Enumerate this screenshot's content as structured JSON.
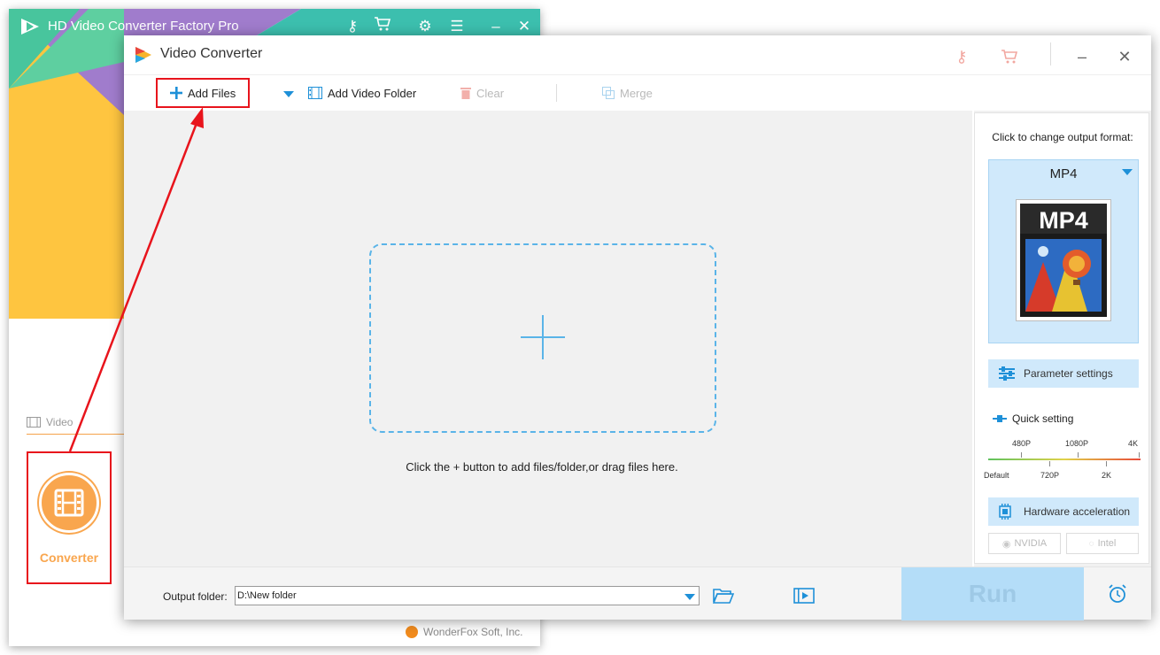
{
  "back_window": {
    "title": "HD Video Converter Factory Pro",
    "video_tab": "Video",
    "converter_label": "Converter",
    "brand": "WonderFox Soft, Inc."
  },
  "front_window": {
    "title": "Video Converter",
    "toolbar": {
      "add_files": "Add Files",
      "add_video_folder": "Add Video Folder",
      "clear": "Clear",
      "merge": "Merge"
    },
    "drop_hint": "Click the + button to add files/folder,or drag files here.",
    "right_panel": {
      "caption": "Click to change output format:",
      "format": "MP4",
      "format_image_text": "MP4",
      "parameter_settings": "Parameter settings",
      "quick_setting": "Quick setting",
      "quality_ticks_top": [
        "480P",
        "1080P",
        "4K"
      ],
      "quality_ticks_bottom": [
        "Default",
        "720P",
        "2K"
      ],
      "hardware_acceleration": "Hardware acceleration",
      "gpu_nvidia": "NVIDIA",
      "gpu_intel": "Intel"
    },
    "bottom": {
      "output_label": "Output folder:",
      "output_path": "D:\\New folder",
      "run": "Run"
    }
  },
  "colors": {
    "accent_blue": "#1e90d8",
    "annotation_red": "#e8141c",
    "converter_orange": "#f9a64e",
    "run_button": "#b4ddf8"
  }
}
